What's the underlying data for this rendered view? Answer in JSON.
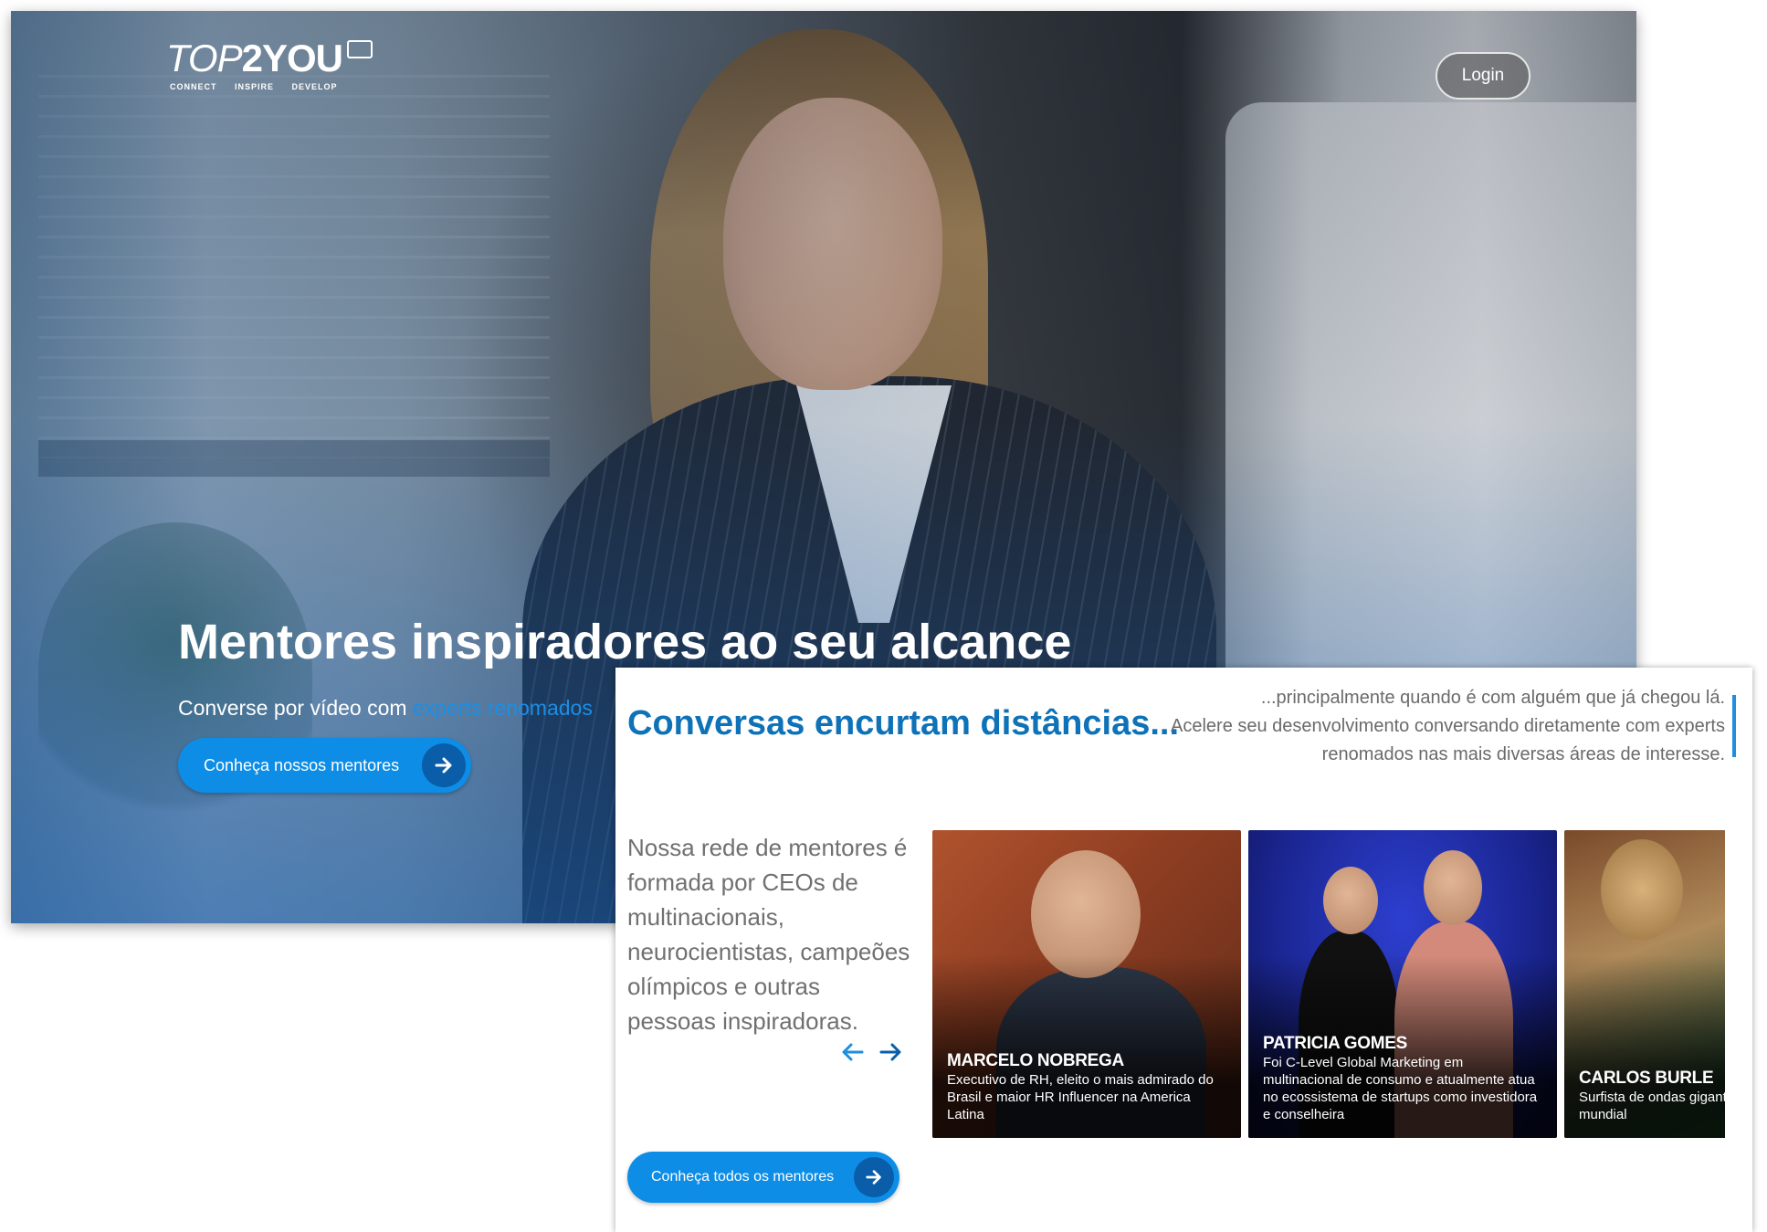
{
  "brand": {
    "name_regular": "TOP",
    "name_bold": "2YOU",
    "tagline": "CONNECT INSPIRE DEVELOP"
  },
  "header": {
    "login_label": "Login"
  },
  "hero": {
    "title": "Mentores inspiradores ao seu alcance",
    "subtitle_prefix": "Converse por vídeo com ",
    "subtitle_highlight": "experts renomados",
    "cta_label": "Conheça nossos mentores"
  },
  "section": {
    "title": "Conversas encurtam distâncias...",
    "intro_line1": "...principalmente quando é com alguém que já chegou lá.",
    "intro_line2": "Acelere seu desenvolvimento conversando diretamente com experts renomados nas mais diversas áreas de interesse.",
    "description": "Nossa rede de mentores é formada por CEOs de multinacionais, neurocientistas, campeões olímpicos e outras pessoas inspiradoras.",
    "cta_label": "Conheça todos os mentores"
  },
  "mentors": [
    {
      "name": "MARCELO NOBREGA",
      "bio": "Executivo de RH, eleito o mais admirado do Brasil e maior HR Influencer na America Latina"
    },
    {
      "name": "PATRICIA GOMES",
      "bio": "Foi C-Level Global Marketing em multinacional de consumo e atualmente atua no ecossistema de startups como investidora e conselheira"
    },
    {
      "name": "CARLOS BURLE",
      "bio": "Surfista de ondas gigantes mundial"
    }
  ],
  "colors": {
    "accent": "#0d8de6",
    "title_blue": "#0e72b8",
    "arrow_circle": "#0a5da8"
  },
  "icons": [
    "arrow-right-icon",
    "arrow-left-icon",
    "speech-bubble-icon"
  ]
}
